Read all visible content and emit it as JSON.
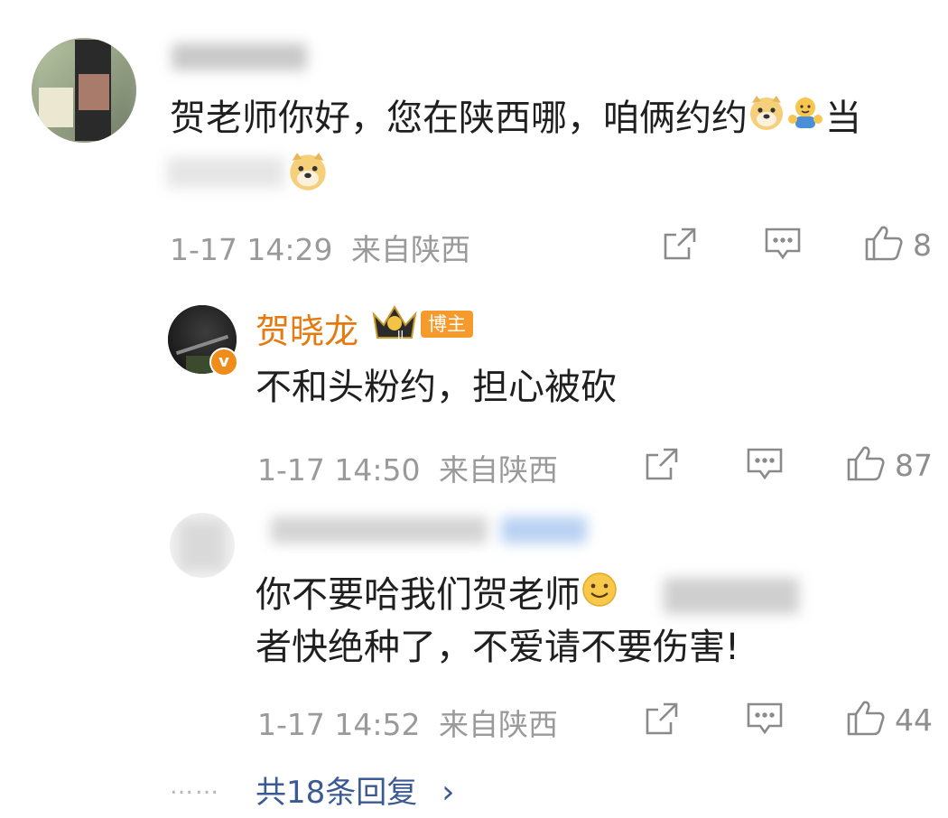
{
  "comment": {
    "text_line1": "贺老师你好，您在陕西哪，咱俩约约",
    "text_line1_tail": "当",
    "time": "1-17 14:29",
    "location": "来自陕西",
    "like_count": "8",
    "emoji_line1": [
      "doge-emoji",
      "hug-emoji"
    ],
    "emoji_line2": [
      "doge-emoji"
    ]
  },
  "replies": [
    {
      "name": "贺晓龙",
      "badge": "博主",
      "text": "不和头粉约，担心被砍",
      "time": "1-17 14:50",
      "location": "来自陕西",
      "like_count": "87"
    },
    {
      "text_line1": "你不要哈我们贺老师",
      "text_line2": "者快绝种了，不爱请不要伤害!",
      "time": "1-17 14:52",
      "location": "来自陕西",
      "like_count": "44"
    }
  ],
  "more_replies": {
    "dots": "……",
    "label": "共18条回复",
    "chevron": "›"
  },
  "colors": {
    "blogger_name": "#e57a10",
    "link": "#3b5a93",
    "meta": "#9a9a9a"
  }
}
